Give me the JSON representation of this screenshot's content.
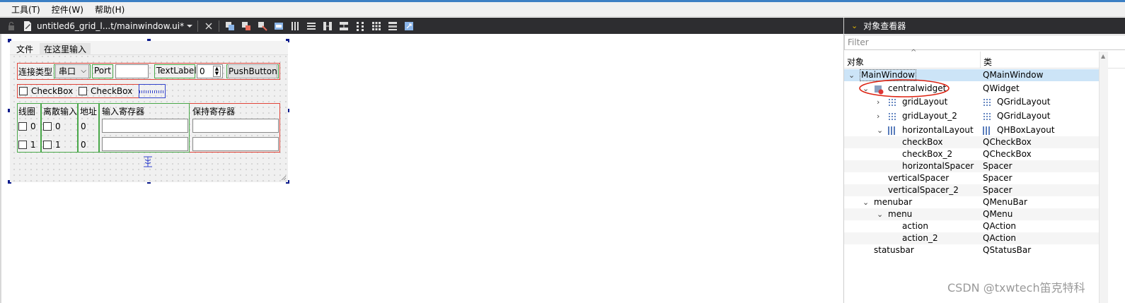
{
  "menubar": {
    "items": [
      "工具(T)",
      "控件(W)",
      "帮助(H)"
    ]
  },
  "toolbar": {
    "doc_tab": "untitled6_grid_l...t/mainwindow.ui*",
    "icons": [
      "lock-icon",
      "document-icon",
      "dropdown-arrow-icon",
      "close-icon",
      "edit-widgets-icon",
      "edit-signals-icon",
      "edit-buddies-icon",
      "edit-tab-order-icon",
      "layout-horizontal-icon",
      "layout-vertical-icon",
      "layout-h-splitter-icon",
      "layout-v-splitter-icon",
      "layout-form-icon",
      "layout-grid-icon",
      "break-layout-icon",
      "adjust-size-icon"
    ]
  },
  "form": {
    "menu": [
      "文件",
      "在这里输入"
    ],
    "row1": {
      "label_conn_type": "连接类型",
      "combo_value": "串口",
      "label_port": "Port",
      "text_label": "TextLabel",
      "spin_value": "0",
      "push_button": "PushButton"
    },
    "row2": {
      "checkbox1": "CheckBox",
      "checkbox2": "CheckBox"
    },
    "grid": {
      "headers": [
        "线圈",
        "离散输入",
        "地址",
        "输入寄存器",
        "保持寄存器"
      ],
      "rows": [
        {
          "coil": "0",
          "discrete": "0",
          "addr": "0"
        },
        {
          "coil": "1",
          "discrete": "1",
          "addr": "0"
        }
      ]
    }
  },
  "inspector": {
    "title": "对象查看器",
    "filter_placeholder": "Filter",
    "col_object": "对象",
    "col_class": "类",
    "rows": [
      {
        "obj": "MainWindow",
        "cls": "QMainWindow"
      },
      {
        "obj": "centralwidget",
        "cls": "QWidget"
      },
      {
        "obj": "gridLayout",
        "cls": "QGridLayout"
      },
      {
        "obj": "gridLayout_2",
        "cls": "QGridLayout"
      },
      {
        "obj": "horizontalLayout",
        "cls": "QHBoxLayout"
      },
      {
        "obj": "checkBox",
        "cls": "QCheckBox"
      },
      {
        "obj": "checkBox_2",
        "cls": "QCheckBox"
      },
      {
        "obj": "horizontalSpacer",
        "cls": "Spacer"
      },
      {
        "obj": "verticalSpacer",
        "cls": "Spacer"
      },
      {
        "obj": "verticalSpacer_2",
        "cls": "Spacer"
      },
      {
        "obj": "menubar",
        "cls": "QMenuBar"
      },
      {
        "obj": "menu",
        "cls": "QMenu"
      },
      {
        "obj": "action",
        "cls": "QAction"
      },
      {
        "obj": "action_2",
        "cls": "QAction"
      },
      {
        "obj": "statusbar",
        "cls": "QStatusBar"
      }
    ]
  },
  "watermark": "CSDN @txwtech笛克特科",
  "colors": {
    "accent_red": "#e0453a",
    "selection": "#cce4f7",
    "dark_bar": "#2d2d30"
  }
}
